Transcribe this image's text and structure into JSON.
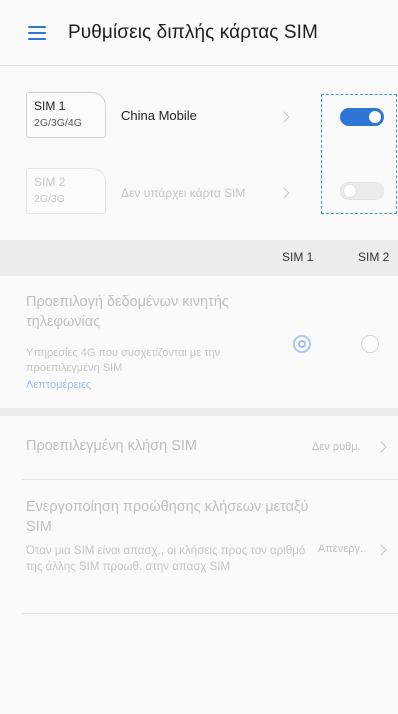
{
  "header": {
    "title": "Ρυθμίσεις διπλής κάρτας SIM"
  },
  "sim1": {
    "name": "SIM 1",
    "type": "2G/3G/4G",
    "carrier": "China Mobile",
    "enabled": true
  },
  "sim2": {
    "name": "SIM 2",
    "type": "2G/3G",
    "carrier": "Δεν υπάρχει κάρτα SIM",
    "enabled": false
  },
  "columns": {
    "sim1": "SIM 1",
    "sim2": "SIM 2"
  },
  "data_default": {
    "title": "Προεπιλογή δεδομένων κινητής τηλεφωνίας",
    "description": "Υπηρεσίες 4G που συσχετίζονται με την προεπιλεγμένη SIM",
    "link": "Λεπτομέρειες",
    "selected": "SIM 1"
  },
  "call_default": {
    "title": "Προεπιλεγμένη κλήση SIM",
    "value": "Δεν ρυθμ."
  },
  "call_forwarding": {
    "title": "Ενεργοποίηση προώθησης κλήσεων μεταξύ SIM",
    "description": "Όταν μια SIM είναι απασχ., οι κλήσεις προς τον αριθμό της άλλης SIM προωθ. στην απασχ SIM",
    "value": "Απενεργ."
  },
  "colors": {
    "accent": "#2f75d6",
    "focus_outline": "#3aa5b2"
  }
}
